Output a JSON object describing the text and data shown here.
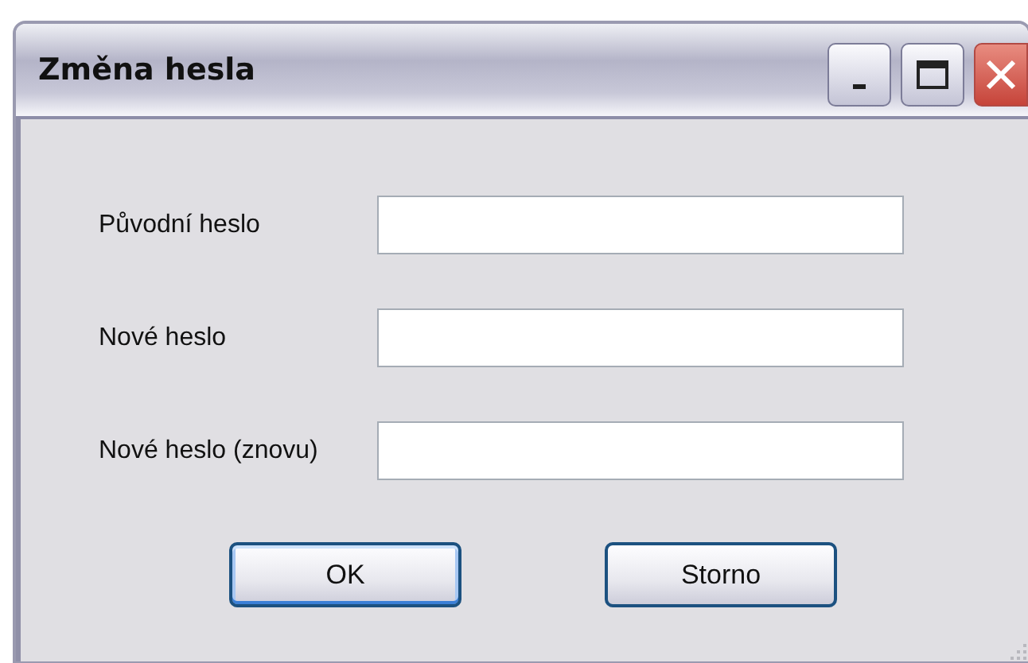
{
  "window": {
    "title": "Změna hesla"
  },
  "fields": [
    {
      "label": "Původní heslo"
    },
    {
      "label": "Nové heslo"
    },
    {
      "label": "Nové heslo (znovu)"
    }
  ],
  "buttons": [
    {
      "label": "OK",
      "default": true
    },
    {
      "label": "Storno",
      "default": false
    }
  ]
}
